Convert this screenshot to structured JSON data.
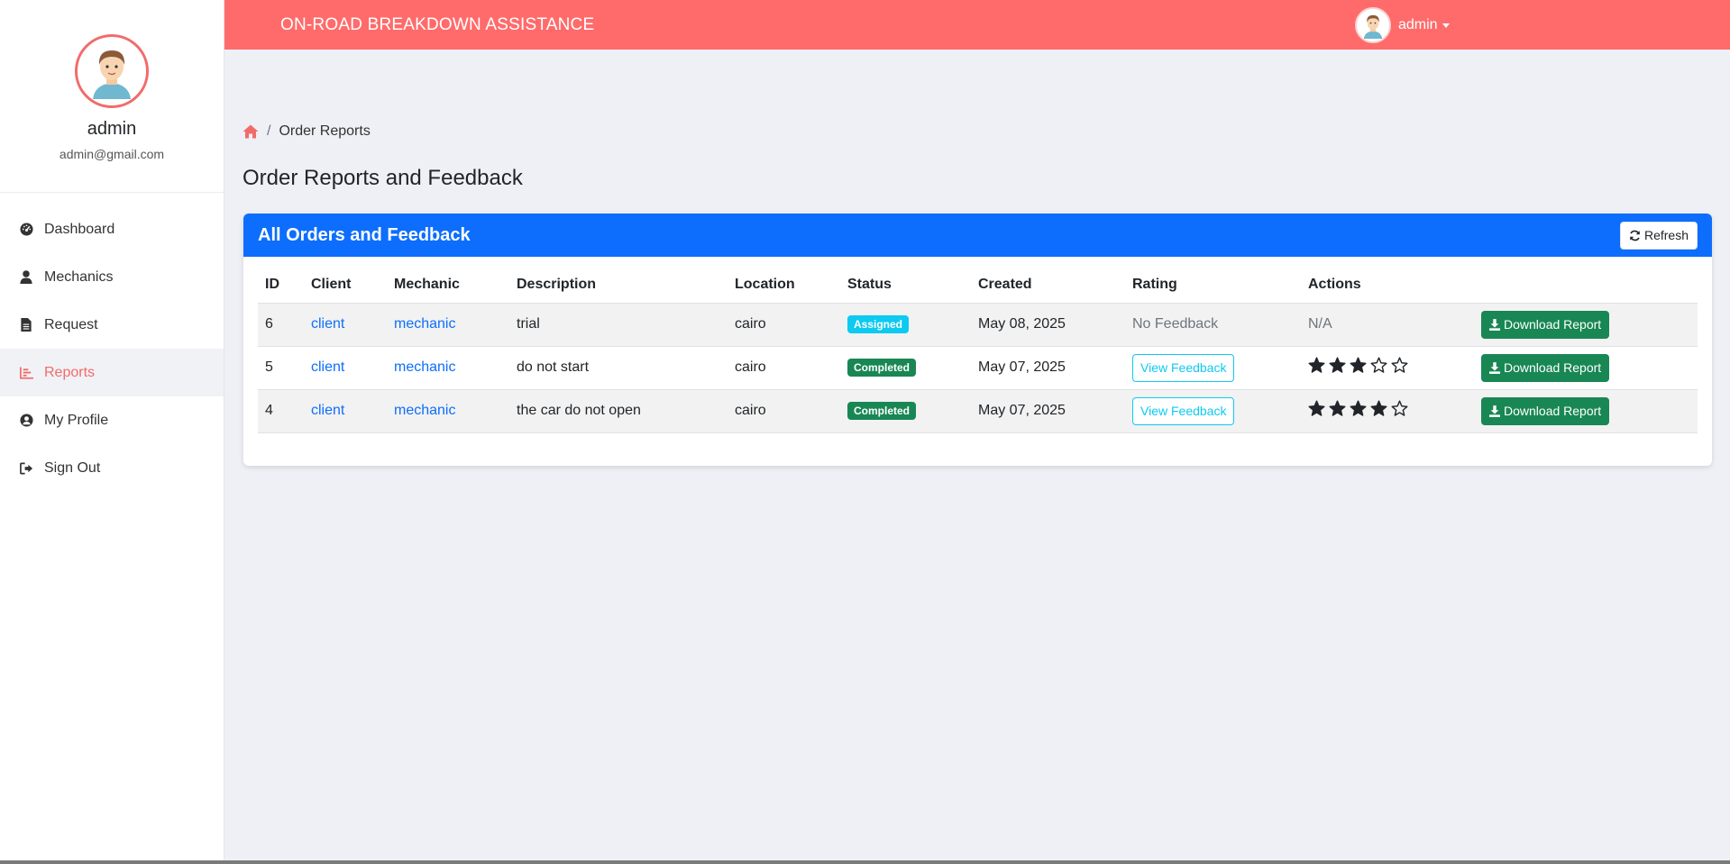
{
  "app": {
    "brand": "ON-ROAD BREAKDOWN ASSISTANCE",
    "accent_color": "#ff6b6b",
    "primary_color": "#0d6efd"
  },
  "topbar": {
    "user_label": "admin"
  },
  "sidebar": {
    "profile_name": "admin",
    "profile_email": "admin@gmail.com",
    "items": [
      {
        "label": "Dashboard",
        "icon": "gauge-icon",
        "active": false
      },
      {
        "label": "Mechanics",
        "icon": "user-icon",
        "active": false
      },
      {
        "label": "Request",
        "icon": "file-icon",
        "active": false
      },
      {
        "label": "Reports",
        "icon": "chart-icon",
        "active": true
      },
      {
        "label": "My Profile",
        "icon": "user-circle-icon",
        "active": false
      },
      {
        "label": "Sign Out",
        "icon": "sign-out-icon",
        "active": false
      }
    ]
  },
  "breadcrumb": {
    "home_icon": "home-icon",
    "separator": "/",
    "current": "Order Reports"
  },
  "page": {
    "title": "Order Reports and Feedback"
  },
  "card": {
    "title": "All Orders and Feedback",
    "refresh_label": "Refresh"
  },
  "table": {
    "headers": [
      "ID",
      "Client",
      "Mechanic",
      "Description",
      "Location",
      "Status",
      "Created",
      "Rating",
      "Actions",
      ""
    ],
    "rows": [
      {
        "id": "6",
        "client": "client",
        "mechanic": "mechanic",
        "description": "trial",
        "location": "cairo",
        "status": "Assigned",
        "created": "May 08, 2025",
        "rating_text": "No Feedback",
        "actions_text": "N/A",
        "stars": null,
        "download_label": "Download Report"
      },
      {
        "id": "5",
        "client": "client",
        "mechanic": "mechanic",
        "description": "do not start",
        "location": "cairo",
        "status": "Completed",
        "created": "May 07, 2025",
        "feedback_label": "View Feedback",
        "stars": 3,
        "download_label": "Download Report"
      },
      {
        "id": "4",
        "client": "client",
        "mechanic": "mechanic",
        "description": "the car do not open",
        "location": "cairo",
        "status": "Completed",
        "created": "May 07, 2025",
        "feedback_label": "View Feedback",
        "stars": 4,
        "download_label": "Download Report"
      }
    ],
    "max_stars": 5
  }
}
